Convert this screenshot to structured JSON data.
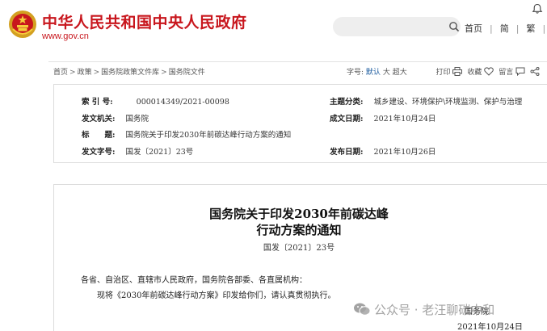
{
  "header": {
    "site_title": "中华人民共和国中央人民政府",
    "site_url": "www.gov.cn",
    "nav": [
      "首页",
      "简",
      "繁",
      "EN"
    ]
  },
  "breadcrumb": [
    "首页",
    "政策",
    "国务院政策文件库",
    "国务院文件"
  ],
  "tools": {
    "font_label": "字号:",
    "font_default": "默认",
    "font_large": "大",
    "font_xlarge": "超大",
    "print": "打印",
    "favorite": "收藏",
    "comment": "留言"
  },
  "info": {
    "index_label": "索 引 号:",
    "index_value": "000014349/2021-00098",
    "subject_label": "主题分类:",
    "subject_value": "城乡建设、环境保护\\环境监测、保护与治理",
    "issuer_label": "发文机关:",
    "issuer_value": "国务院",
    "created_label": "成文日期:",
    "created_value": "2021年10月24日",
    "title_label": "标　　题:",
    "title_value": "国务院关于印发2030年前碳达峰行动方案的通知",
    "docno_label": "发文字号:",
    "docno_value": "国发〔2021〕23号",
    "published_label": "发布日期:",
    "published_value": "2021年10月26日"
  },
  "document": {
    "title_line1": "国务院关于印发2030年前碳达峰",
    "title_line2": "行动方案的通知",
    "number": "国发〔2021〕23号",
    "recipients": "各省、自治区、直辖市人民政府，国务院各部委、各直属机构：",
    "body": "现将《2030年前碳达峰行动方案》印发给你们，请认真贯彻执行。",
    "signer": "国务院",
    "date": "2021年10月24日"
  },
  "watermark": {
    "text": "公众号 · 老汪聊碳中和"
  }
}
